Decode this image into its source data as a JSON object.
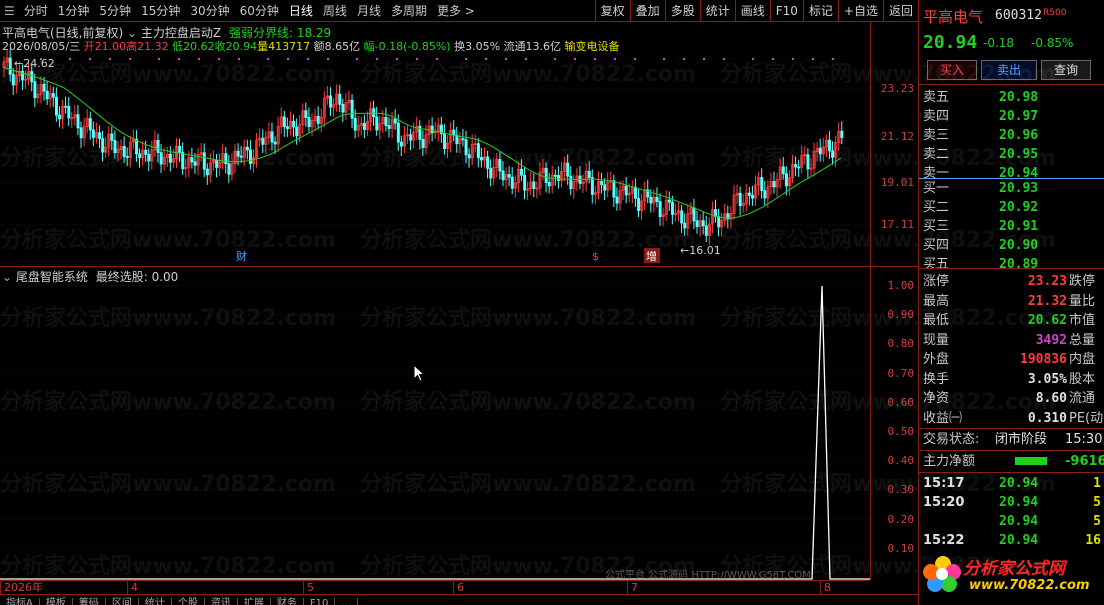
{
  "toolbar": {
    "periods": [
      "分时",
      "1分钟",
      "5分钟",
      "15分钟",
      "30分钟",
      "60分钟",
      "日线",
      "周线",
      "月线",
      "多周期",
      "更多 >"
    ],
    "selected": "日线",
    "buttons": [
      "复权",
      "叠加",
      "多股",
      "统计",
      "画线",
      "F10",
      "标记",
      "+自选",
      "返回"
    ]
  },
  "chart_info": {
    "stock_title": "平高电气(日线,前复权)",
    "formula": "主力控盘启动Z",
    "formula_line": "强弱分界线: 18.29",
    "date": "2026/08/05/三",
    "open": "开21.00",
    "high": "高21.32",
    "low": "低20.62",
    "close": "收20.94",
    "volume": "量413717",
    "amount": "额8.65亿",
    "change": "幅-0.18(-0.85%)",
    "turnover": "换3.05%",
    "float": "流通13.6亿",
    "sector": "输变电设备"
  },
  "annotations": {
    "high_mark": "24.62",
    "low_mark": "16.01",
    "marker_cai": "财",
    "marker_s": "$",
    "marker_zeng": "增"
  },
  "indicator": {
    "title": "尾盘智能系统",
    "value": "最终选股: 0.00"
  },
  "yaxis_main": [
    "23.23",
    "21.12",
    "19.01",
    "17.11"
  ],
  "yaxis_ind": [
    "1.00",
    "0.90",
    "0.80",
    "0.70",
    "0.60",
    "0.50",
    "0.40",
    "0.30",
    "0.20",
    "0.10"
  ],
  "xaxis": [
    "2026年",
    "4",
    "5",
    "6",
    "7",
    "8"
  ],
  "bottom_tabs": [
    "指标A",
    "模板",
    "筹码",
    "区间",
    "统计",
    "个股",
    "资讯",
    "扩展",
    "财务",
    "F10",
    "…"
  ],
  "colors": {
    "up": "#ff3c3c",
    "down": "#54ffff",
    "ma": "#20d020",
    "axis": "#8b1a1a"
  },
  "quote": {
    "name": "平高电气",
    "code": "600312",
    "tag": "R500",
    "price": "20.94",
    "change": "-0.18",
    "pct": "-0.85%",
    "buy_btn": "买入",
    "sell_btn": "卖出",
    "query_btn": "查询",
    "asks": [
      {
        "label": "卖五",
        "price": "20.98"
      },
      {
        "label": "卖四",
        "price": "20.97"
      },
      {
        "label": "卖三",
        "price": "20.96"
      },
      {
        "label": "卖二",
        "price": "20.95"
      },
      {
        "label": "卖一",
        "price": "20.94"
      }
    ],
    "bids": [
      {
        "label": "买一",
        "price": "20.93"
      },
      {
        "label": "买二",
        "price": "20.92"
      },
      {
        "label": "买三",
        "price": "20.91"
      },
      {
        "label": "买四",
        "price": "20.90"
      },
      {
        "label": "买五",
        "price": "20.89"
      }
    ],
    "stats": [
      {
        "l1": "涨停",
        "v1": "23.23",
        "c1": "#ff3c3c",
        "l2": "跌停"
      },
      {
        "l1": "最高",
        "v1": "21.32",
        "c1": "#ff3c3c",
        "l2": "量比"
      },
      {
        "l1": "最低",
        "v1": "20.62",
        "c1": "#20d020",
        "l2": "市值"
      },
      {
        "l1": "现量",
        "v1": "3492",
        "c1": "#d040d0",
        "l2": "总量"
      },
      {
        "l1": "外盘",
        "v1": "190836",
        "c1": "#ff3c3c",
        "l2": "内盘"
      },
      {
        "l1": "换手",
        "v1": "3.05%",
        "c1": "#e0e0e0",
        "l2": "股本"
      },
      {
        "l1": "净资",
        "v1": "8.60",
        "c1": "#e0e0e0",
        "l2": "流通"
      },
      {
        "l1": "收益㈠",
        "v1": "0.310",
        "c1": "#e0e0e0",
        "l2": "PE(动)"
      }
    ],
    "trade_state": "交易状态:",
    "trade_state_value": "闭市阶段",
    "trade_time": "15:30",
    "net_flow_label": "主力净额",
    "net_flow_value": "-9616",
    "ticks": [
      {
        "time": "15:17",
        "price": "20.94",
        "vol": "1"
      },
      {
        "time": "15:20",
        "price": "20.94",
        "vol": "5"
      },
      {
        "time": "",
        "price": "20.94",
        "vol": "5"
      },
      {
        "time": "15:22",
        "price": "20.94",
        "vol": "16"
      }
    ],
    "logo_text": "分析家公式网",
    "logo_url": "www.70822.com"
  },
  "watermark": "分析家公式网www.70822.com",
  "footer_watermark": "公式平台  公式源码 HTTP://WWW.G58T.COM"
}
